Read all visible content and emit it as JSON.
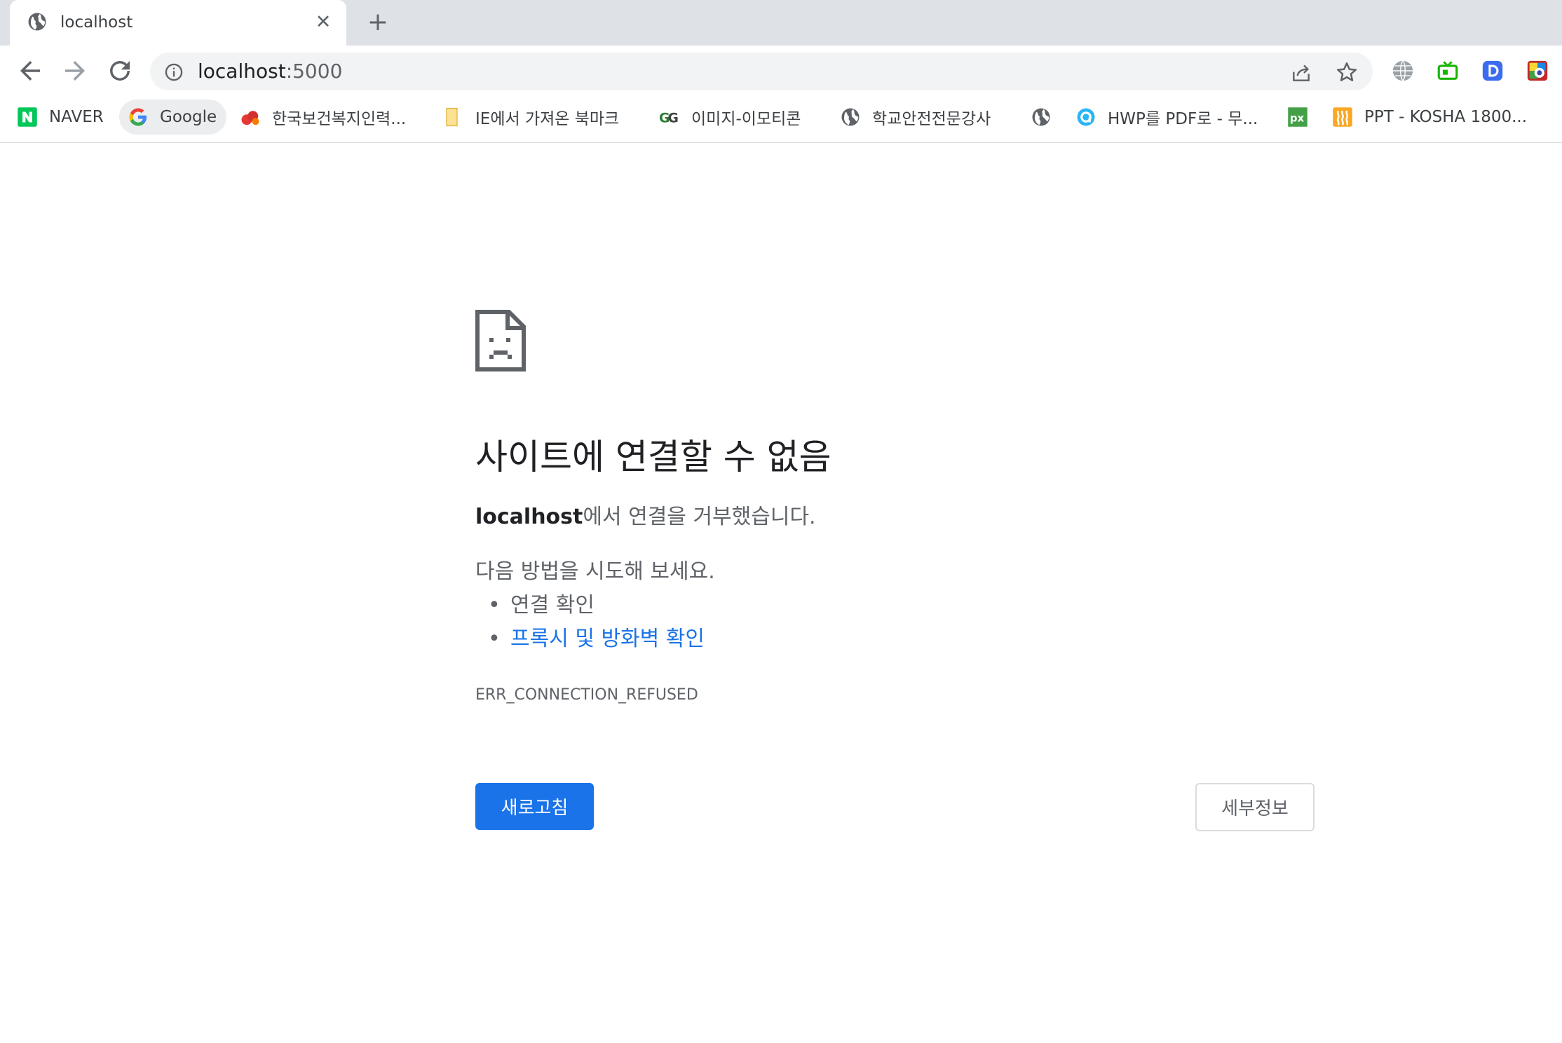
{
  "tab": {
    "title": "localhost",
    "close_glyph": "✕",
    "new_tab_glyph": "+"
  },
  "omnibox": {
    "host": "localhost",
    "port": ":5000"
  },
  "bookmarks": [
    {
      "label": "NAVER",
      "icon": "naver-icon"
    },
    {
      "label": "Google",
      "icon": "google-icon"
    },
    {
      "label": "한국보건복지인력...",
      "icon": "red-fruit-icon"
    },
    {
      "label": "IE에서 가져온 북마크",
      "icon": "folder-icon"
    },
    {
      "label": "이미지-이모티콘",
      "icon": "gg-icon"
    },
    {
      "label": "학교안전전문강사",
      "icon": "globe-icon"
    },
    {
      "label": "",
      "icon": "globe-icon"
    },
    {
      "label": "HWP를 PDF로 - 무...",
      "icon": "hwp-icon"
    },
    {
      "label": "",
      "icon": "px-icon"
    },
    {
      "label": "PPT - KOSHA 1800...",
      "icon": "ppt-icon"
    }
  ],
  "error": {
    "title": "사이트에 연결할 수 없음",
    "host": "localhost",
    "desc_suffix": "에서 연결을 거부했습니다.",
    "try_label": "다음 방법을 시도해 보세요.",
    "suggestions": [
      "연결 확인",
      "프록시 및 방화벽 확인"
    ],
    "code": "ERR_CONNECTION_REFUSED",
    "reload_label": "새로고침",
    "details_label": "세부정보"
  },
  "colors": {
    "accent": "#1a73e8",
    "naver": "#03c75a",
    "tabstrip": "#dee1e6"
  }
}
